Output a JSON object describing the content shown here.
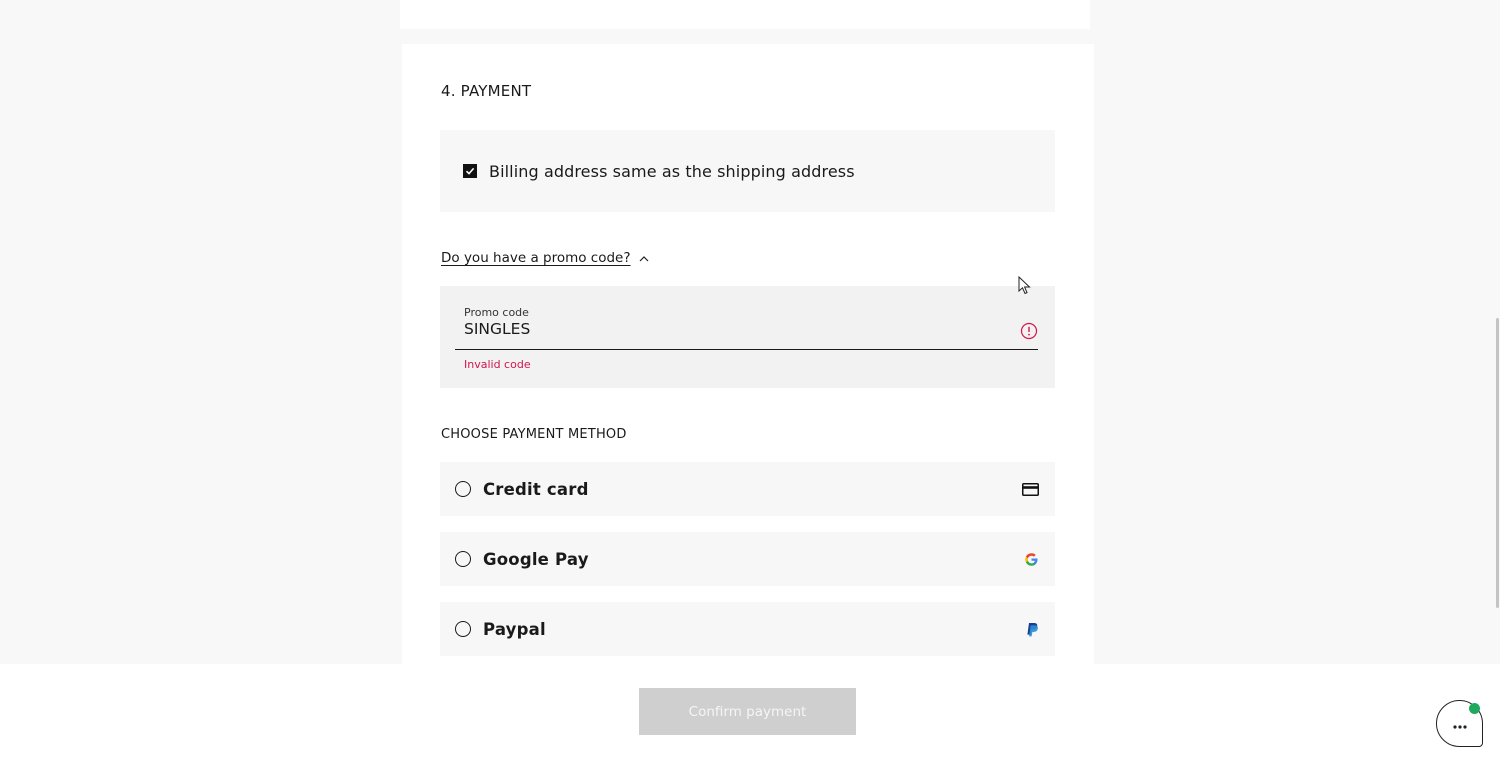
{
  "payment_section": {
    "title": "4. PAYMENT",
    "billing": {
      "label": "Billing address same as the shipping address",
      "checked": true
    },
    "promo": {
      "toggle_label": "Do you have a promo code?",
      "toggle_icon": "chevron-up-icon",
      "field_label": "Promo code",
      "value": "SINGLES",
      "error": "Invalid code",
      "error_color": "#d2174b"
    },
    "methods_title": "CHOOSE PAYMENT METHOD",
    "methods": [
      {
        "label": "Credit card",
        "icon": "credit-card-icon",
        "selected": false
      },
      {
        "label": "Google Pay",
        "icon": "google-icon",
        "selected": false
      },
      {
        "label": "Paypal",
        "icon": "paypal-icon",
        "selected": false
      }
    ]
  },
  "footer": {
    "confirm_label": "Confirm payment",
    "confirm_enabled": false,
    "chat_icon": "chat-more-icon",
    "chat_status_color": "#1eaa5e"
  }
}
